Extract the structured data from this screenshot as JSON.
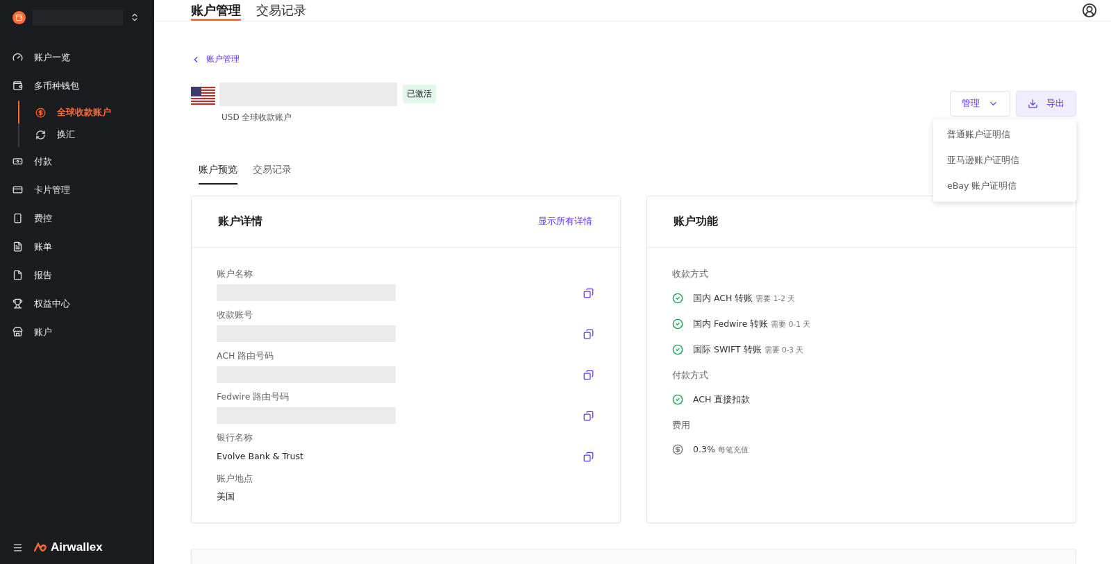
{
  "sidebar": {
    "items": [
      {
        "label": "账户一览",
        "selected": false
      },
      {
        "label": "多币种钱包",
        "selected": false,
        "expanded": true,
        "children": [
          {
            "label": "全球收款账户",
            "selected": true
          },
          {
            "label": "换汇",
            "selected": false
          }
        ]
      },
      {
        "label": "付款",
        "selected": false
      },
      {
        "label": "卡片管理",
        "selected": false
      },
      {
        "label": "费控",
        "selected": false
      },
      {
        "label": "账单",
        "selected": false
      },
      {
        "label": "报告",
        "selected": false
      },
      {
        "label": "权益中心",
        "selected": false
      },
      {
        "label": "账户",
        "selected": false
      }
    ],
    "brand": "Airwallex"
  },
  "tabs": [
    {
      "label": "账户管理",
      "selected": true
    },
    {
      "label": "交易记录",
      "selected": false
    }
  ],
  "breadcrumb": "账户管理",
  "account": {
    "status": "已激活",
    "subtitle": "USD 全球收款账户"
  },
  "actions": {
    "manage": "管理",
    "export": "导出"
  },
  "export_menu": {
    "open": true,
    "items": [
      "普通账户证明信",
      "亚马逊账户证明信",
      "eBay 账户证明信"
    ]
  },
  "sub_tabs": [
    {
      "label": "账户预览",
      "selected": true
    },
    {
      "label": "交易记录",
      "selected": false
    }
  ],
  "details": {
    "title": "账户详情",
    "link": "显示所有详情",
    "fields": [
      {
        "label": "账户名称",
        "redacted": true,
        "copyable": true
      },
      {
        "label": "收款账号",
        "redacted": true,
        "copyable": true
      },
      {
        "label": "ACH 路由号码",
        "redacted": true,
        "copyable": true
      },
      {
        "label": "Fedwire 路由号码",
        "redacted": true,
        "copyable": true
      },
      {
        "label": "银行名称",
        "value": "Evolve Bank & Trust",
        "redacted": false,
        "copyable": true
      },
      {
        "label": "账户地点",
        "value": "美国",
        "redacted": false,
        "copyable": false
      }
    ]
  },
  "features": {
    "title": "账户功能",
    "sections": [
      {
        "heading": "收款方式",
        "items": [
          {
            "kind": "check",
            "text": "国内 ACH 转账",
            "note": "需要 1-2 天"
          },
          {
            "kind": "check",
            "text": "国内 Fedwire 转账",
            "note": "需要 0-1 天"
          },
          {
            "kind": "check",
            "text": "国际 SWIFT 转账",
            "note": "需要 0-3 天"
          }
        ]
      },
      {
        "heading": "付款方式",
        "items": [
          {
            "kind": "check",
            "text": "ACH 直接扣款"
          }
        ]
      },
      {
        "heading": "费用",
        "items": [
          {
            "kind": "fee",
            "text": "0.3%",
            "note": "每笔充值"
          }
        ]
      }
    ]
  }
}
